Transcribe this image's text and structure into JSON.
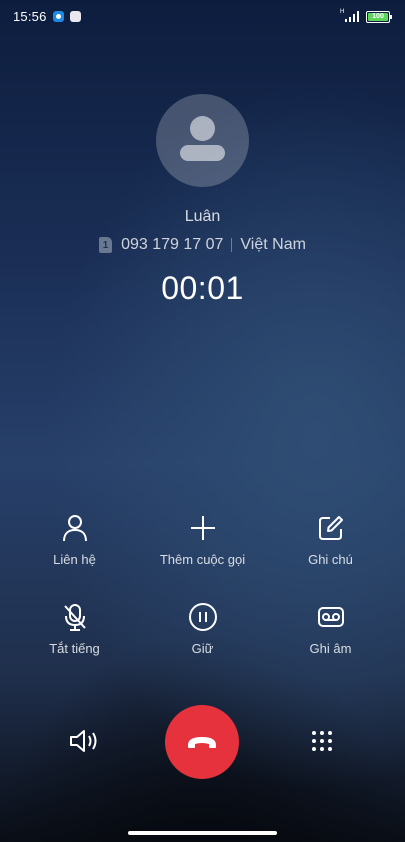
{
  "status_bar": {
    "time": "15:56",
    "network": "H",
    "battery": "100"
  },
  "caller": {
    "name": "Luân",
    "sim_slot": "1",
    "number": "093 179 17 07",
    "country": "Việt Nam",
    "duration": "00:01"
  },
  "actions": [
    {
      "label": "Liên hệ",
      "icon": "contact-icon"
    },
    {
      "label": "Thêm cuộc gọi",
      "icon": "add-call-icon"
    },
    {
      "label": "Ghi chú",
      "icon": "note-icon"
    },
    {
      "label": "Tắt tiếng",
      "icon": "mute-icon"
    },
    {
      "label": "Giữ",
      "icon": "hold-icon"
    },
    {
      "label": "Ghi âm",
      "icon": "record-icon"
    }
  ],
  "bottom": {
    "speaker": "speaker-icon",
    "end_call": "end-call-icon",
    "keypad": "keypad-icon"
  },
  "colors": {
    "end_call": "#e5323d",
    "battery": "#5bd65b"
  }
}
